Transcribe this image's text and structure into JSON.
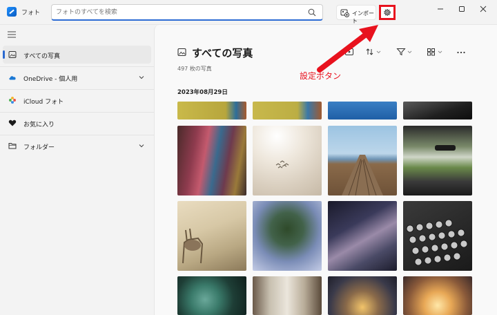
{
  "app": {
    "title": "フォト"
  },
  "search": {
    "placeholder": "フォトのすべてを検索",
    "value": ""
  },
  "toolbar": {
    "import_label": "インポート",
    "settings_icon": "gear-icon"
  },
  "window_controls": [
    "minimize",
    "maximize",
    "close"
  ],
  "sidebar": {
    "items": [
      {
        "label": "すべての写真",
        "icon": "photo-icon",
        "selected": true
      },
      {
        "label": "OneDrive - 個人用",
        "icon": "cloud-icon",
        "expandable": true
      },
      {
        "label": "iCloud フォト",
        "icon": "icloud-icon"
      },
      {
        "label": "お気に入り",
        "icon": "heart-icon"
      },
      {
        "label": "フォルダー",
        "icon": "folder-icon",
        "expandable": true
      }
    ]
  },
  "main": {
    "title": "すべての写真",
    "count": "497 枚の写真",
    "date_header": "2023年08月29日",
    "tools": [
      "slideshow-icon",
      "sort-icon",
      "filter-icon",
      "view-icon",
      "more-icon"
    ]
  },
  "annotation": {
    "label": "設定ボタン",
    "color": "#e8121e"
  },
  "colors": {
    "accent": "#2c6bd4",
    "highlight": "#e8121e"
  }
}
